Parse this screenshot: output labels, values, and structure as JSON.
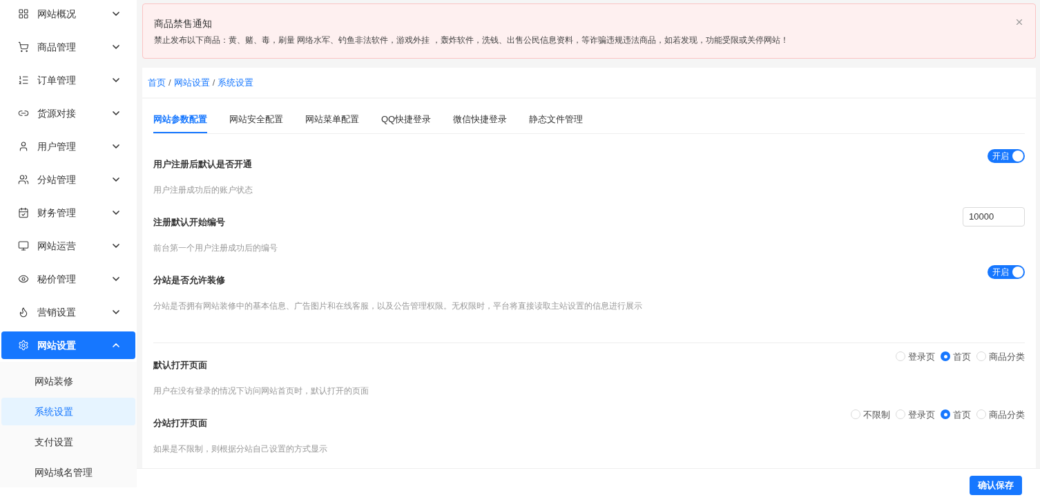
{
  "sidebar": {
    "items": [
      {
        "label": "网站概况",
        "expanded": false,
        "selected": false
      },
      {
        "label": "商品管理",
        "expanded": false,
        "selected": false
      },
      {
        "label": "订单管理",
        "expanded": false,
        "selected": false
      },
      {
        "label": "货源对接",
        "expanded": false,
        "selected": false
      },
      {
        "label": "用户管理",
        "expanded": false,
        "selected": false
      },
      {
        "label": "分站管理",
        "expanded": false,
        "selected": false
      },
      {
        "label": "财务管理",
        "expanded": false,
        "selected": false
      },
      {
        "label": "网站运营",
        "expanded": false,
        "selected": false
      },
      {
        "label": "秘价管理",
        "expanded": false,
        "selected": false
      },
      {
        "label": "营销设置",
        "expanded": false,
        "selected": false
      },
      {
        "label": "网站设置",
        "expanded": true,
        "selected": true,
        "children": [
          {
            "label": "网站装修",
            "selected": false
          },
          {
            "label": "系统设置",
            "selected": true
          },
          {
            "label": "支付设置",
            "selected": false
          },
          {
            "label": "网站域名管理",
            "selected": false
          }
        ]
      }
    ]
  },
  "notice": {
    "title": "商品禁售通知",
    "text": "禁止发布以下商品：黄、赌、毒，刷量 网络水军、钓鱼非法软件，游戏外挂 ，轰炸软件，洗钱、出售公民信息资料，等诈骗违规违法商品，如若发现，功能受限或关停网站！"
  },
  "breadcrumb": {
    "separator": "/",
    "items": [
      "首页",
      "网站设置",
      "系统设置"
    ]
  },
  "tabs": [
    {
      "label": "网站参数配置",
      "selected": true
    },
    {
      "label": "网站安全配置",
      "selected": false
    },
    {
      "label": "网站菜单配置",
      "selected": false
    },
    {
      "label": "QQ快捷登录",
      "selected": false
    },
    {
      "label": "微信快捷登录",
      "selected": false
    },
    {
      "label": "静态文件管理",
      "selected": false
    }
  ],
  "sections": [
    [
      {
        "kind": "switch",
        "title": "用户注册后默认是否开通",
        "description": "用户注册成功后的账户状态",
        "on": true,
        "switch_label": "开启"
      },
      {
        "kind": "input",
        "title": "注册默认开始编号",
        "description": "前台第一个用户注册成功后的编号",
        "value": "10000"
      },
      {
        "kind": "switch",
        "title": "分站是否允许装修",
        "description": "分站是否拥有网站装修中的基本信息、广告图片和在线客服，以及公告管理权限。无权限时，平台将直接读取主站设置的信息进行展示",
        "on": true,
        "switch_label": "开启"
      }
    ],
    [
      {
        "kind": "radio",
        "title": "默认打开页面",
        "description": "用户在没有登录的情况下访问网站首页时，默认打开的页面",
        "options": [
          {
            "label": "登录页",
            "selected": false
          },
          {
            "label": "首页",
            "selected": true
          },
          {
            "label": "商品分类",
            "selected": false
          }
        ]
      },
      {
        "kind": "radio",
        "title": "分站打开页面",
        "description": "如果是不限制，则根据分站自己设置的方式显示",
        "options": [
          {
            "label": "不限制",
            "selected": false
          },
          {
            "label": "登录页",
            "selected": false
          },
          {
            "label": "首页",
            "selected": true
          },
          {
            "label": "商品分类",
            "selected": false
          }
        ]
      }
    ]
  ],
  "footer": {
    "save_button": "确认保存"
  }
}
